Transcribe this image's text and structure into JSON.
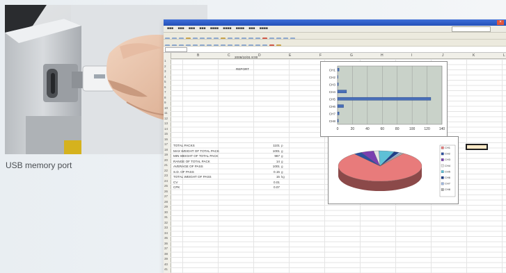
{
  "caption": "USB memory port",
  "photo": {
    "usb_label": "USB"
  },
  "spreadsheet": {
    "header_cell": "2008/10/31 8:00",
    "header_sub": "REPORT",
    "columns": [
      "B",
      "C",
      "D",
      "E",
      "F",
      "G",
      "H",
      "I",
      "J",
      "K",
      "L"
    ],
    "rows": [
      {
        "label": "TOTAL PACKS",
        "value": "1101",
        "unit": "p"
      },
      {
        "label": "MAX WEIGHT OF TOTAL PACK",
        "value": "1001",
        "unit": "g"
      },
      {
        "label": "MIN WEIGHT OF TOTAL PACK",
        "value": "987",
        "unit": "g"
      },
      {
        "label": "RANGE OF TOTAL PACK",
        "value": "14",
        "unit": "g"
      },
      {
        "label": "AVERAGE OF PASS",
        "value": "1001",
        "unit": "g"
      },
      {
        "label": "S.D. OF PASS",
        "value": "0.15",
        "unit": "g"
      },
      {
        "label": "TOTAL WEIGHT OF PASS",
        "value": "15",
        "unit": "kg"
      },
      {
        "label": "CV",
        "value": "0.01",
        "unit": ""
      },
      {
        "label": "CPK",
        "value": "0.07",
        "unit": ""
      }
    ]
  },
  "chart_data": [
    {
      "type": "bar",
      "orientation": "horizontal",
      "categories": [
        "CH1",
        "CH2",
        "CH3",
        "CH4",
        "CH5",
        "CH6",
        "CH7",
        "CH8"
      ],
      "values": [
        2,
        0,
        1,
        12,
        125,
        8,
        2,
        1
      ],
      "xlim": [
        0,
        140
      ],
      "xticks": [
        "0",
        "20",
        "40",
        "60",
        "80",
        "100",
        "120",
        "140"
      ]
    },
    {
      "type": "pie",
      "legend": [
        "CH1",
        "CH2",
        "CH3",
        "CH4",
        "CH5",
        "CH6",
        "CH7",
        "CH8"
      ],
      "values": [
        80,
        3,
        5,
        2,
        6,
        2,
        1,
        1
      ],
      "colors": [
        "#e87b7b",
        "#2c4fa0",
        "#7a3fb0",
        "#e3e3e3",
        "#5ec0d6",
        "#1f3f8a",
        "#9fb7de",
        "#b0b0b0"
      ],
      "legend_placement": "right"
    }
  ]
}
